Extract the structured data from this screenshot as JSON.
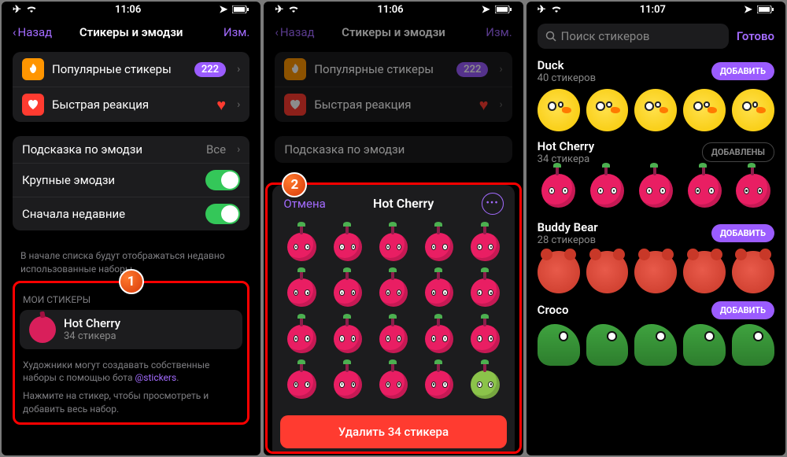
{
  "status": {
    "time1": "11:06",
    "time2": "11:06",
    "time3": "11:07"
  },
  "nav": {
    "back": "Назад",
    "title": "Стикеры и эмодзи",
    "edit": "Изм."
  },
  "popular": {
    "label": "Популярные стикеры",
    "badge": "222"
  },
  "quick": {
    "label": "Быстрая реакция"
  },
  "hint": {
    "label": "Подсказка по эмодзи",
    "value": "Все"
  },
  "large": {
    "label": "Крупные эмодзи"
  },
  "recent": {
    "label": "Сначала недавние"
  },
  "caption1": "В начале списка будут отображаться недавно использованные наборы.",
  "my_header": "МОИ СТИКЕРЫ",
  "my_pack": {
    "name": "Hot Cherry",
    "count": "34 стикера"
  },
  "caption2a": "Художники могут создавать собственные наборы с помощью бота ",
  "caption2b": "@stickers",
  "caption2c": ".",
  "caption3": "Нажмите на стикер, чтобы просмотреть и добавить весь набор.",
  "sheet": {
    "cancel": "Отмена",
    "title": "Hot Cherry",
    "delete": "Удалить 34 стикера"
  },
  "search": {
    "placeholder": "Поиск стикеров",
    "done": "Готово"
  },
  "packs": [
    {
      "name": "Duck",
      "count": "40 стикеров",
      "btn": "ДОБАВИТЬ",
      "added": false,
      "kind": "duck"
    },
    {
      "name": "Hot Cherry",
      "count": "34 стикера",
      "btn": "ДОБАВЛЕНЫ",
      "added": true,
      "kind": "cherry"
    },
    {
      "name": "Buddy Bear",
      "count": "28 стикеров",
      "btn": "ДОБАВИТЬ",
      "added": false,
      "kind": "bear"
    },
    {
      "name": "Croco",
      "count": "",
      "btn": "ДОБАВИТЬ",
      "added": false,
      "kind": "croco"
    }
  ],
  "steps": {
    "one": "1",
    "two": "2"
  }
}
